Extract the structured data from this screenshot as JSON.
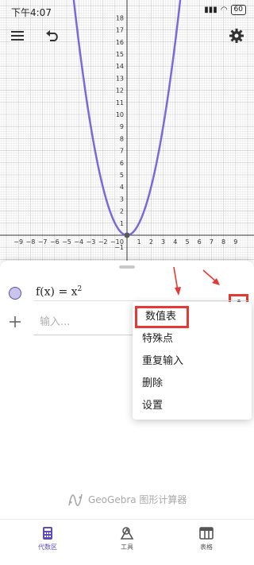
{
  "status_bar": {
    "time": "下午4:07",
    "battery": "60"
  },
  "graph": {
    "x_ticks": [
      "−9",
      "−8",
      "−7",
      "−6",
      "−5",
      "−4",
      "−3",
      "−2",
      "−1",
      "1",
      "2",
      "3",
      "4",
      "5",
      "6",
      "7",
      "8",
      "9"
    ],
    "y_ticks": [
      "18",
      "17",
      "16",
      "15",
      "14",
      "13",
      "12",
      "11",
      "10",
      "9",
      "8",
      "7",
      "6",
      "5",
      "4",
      "3",
      "2",
      "1",
      "−1"
    ],
    "origin_label": "0",
    "curve_color": "#6b5bd6",
    "point_color": "#5a5a5a"
  },
  "algebra": {
    "expression": {
      "lhs": "f(x) = x",
      "exponent": "2"
    },
    "input_placeholder": "输入..."
  },
  "menu": {
    "items": [
      "数值表",
      "特殊点",
      "重复输入",
      "删除",
      "设置"
    ]
  },
  "brand": {
    "name": "GeoGebra 图形计算器"
  },
  "nav": {
    "items": [
      "代数区",
      "工具",
      "表格"
    ],
    "accent": "#5b4bbf"
  },
  "annotation_color": "#e53935"
}
